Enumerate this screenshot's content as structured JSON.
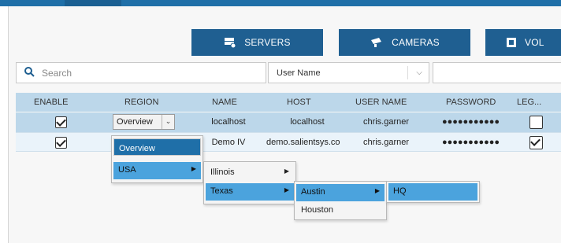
{
  "toolbar": {
    "servers_label": "SERVERS",
    "cameras_label": "CAMERAS",
    "third_label": "VOL"
  },
  "search": {
    "placeholder": "Search"
  },
  "filter": {
    "selected": "User Name"
  },
  "table": {
    "headers": [
      "ENABLE",
      "REGION",
      "NAME",
      "HOST",
      "USER NAME",
      "PASSWORD",
      "LEG..."
    ],
    "rows": [
      {
        "enable": true,
        "region": "Overview",
        "name": "localhost",
        "host": "localhost",
        "user": "chris.garner",
        "password": "●●●●●●●●●●●",
        "legacy": false
      },
      {
        "enable": true,
        "region": "",
        "name": "Demo IV",
        "host": "demo.salientsys.co",
        "user": "chris.garner",
        "password": "●●●●●●●●●●●",
        "legacy": true
      }
    ]
  },
  "region_menu": {
    "level1": [
      "Overview",
      "USA"
    ],
    "level2": [
      "Illinois",
      "Texas"
    ],
    "level3": [
      "Austin",
      "Houston"
    ],
    "level4": [
      "HQ"
    ]
  },
  "colors": {
    "accent": "#1f5f91",
    "header_bg": "#bcd7ea",
    "highlight": "#4ba3dd"
  }
}
